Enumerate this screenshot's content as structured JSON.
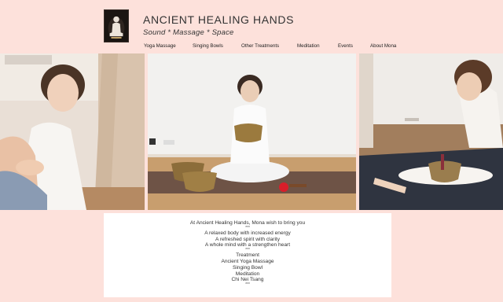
{
  "header": {
    "title": "ANCIENT HEALING HANDS",
    "tagline": "Sound * Massage * Space",
    "logo_icon": "meditating-figure-logo"
  },
  "nav": {
    "items": [
      {
        "label": "Yoga Massage"
      },
      {
        "label": "Singing Bowls"
      },
      {
        "label": "Other Treatments"
      },
      {
        "label": "Meditation"
      },
      {
        "label": "Events"
      },
      {
        "label": "About Mona"
      }
    ]
  },
  "intro": {
    "heading": "At Ancient Healing Hands, Mona wish to bring you",
    "sep1": "***",
    "benefits": [
      "A relaxed body with increased energy",
      "A refreshed spirit with clarity",
      "A whole mind with a strengthen heart"
    ],
    "sep2": "***",
    "treatments_heading": "Treatment",
    "treatments": [
      "Ancient Yoga Massage",
      "Singing Bowl",
      "Meditation",
      "Chi Nei Tsang"
    ],
    "sep3": "***"
  },
  "colors": {
    "background": "#fde1db",
    "text": "#333333",
    "panel": "#ffffff"
  }
}
